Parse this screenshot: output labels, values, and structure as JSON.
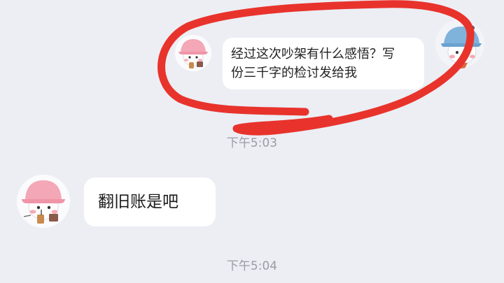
{
  "conversation": {
    "outgoing_message": {
      "line1": "经过这次吵架有什么感悟？写",
      "line2": "份三千字的检讨发给我"
    },
    "timestamp_1": "下午5:03",
    "incoming_message": {
      "text": "翻旧账是吧"
    },
    "timestamp_2": "下午5:04"
  },
  "colors": {
    "background": "#eceef4",
    "bubble": "#ffffff",
    "timestamp_text": "#9a9ca6",
    "annotation_stroke": "#e8332c"
  },
  "icons": {
    "self_avatar": "cartoon-boy-blue-hat-icon",
    "quoted_avatar": "cartoon-girl-pink-hat-icon",
    "other_avatar": "cartoon-girl-pink-hat-icon"
  }
}
